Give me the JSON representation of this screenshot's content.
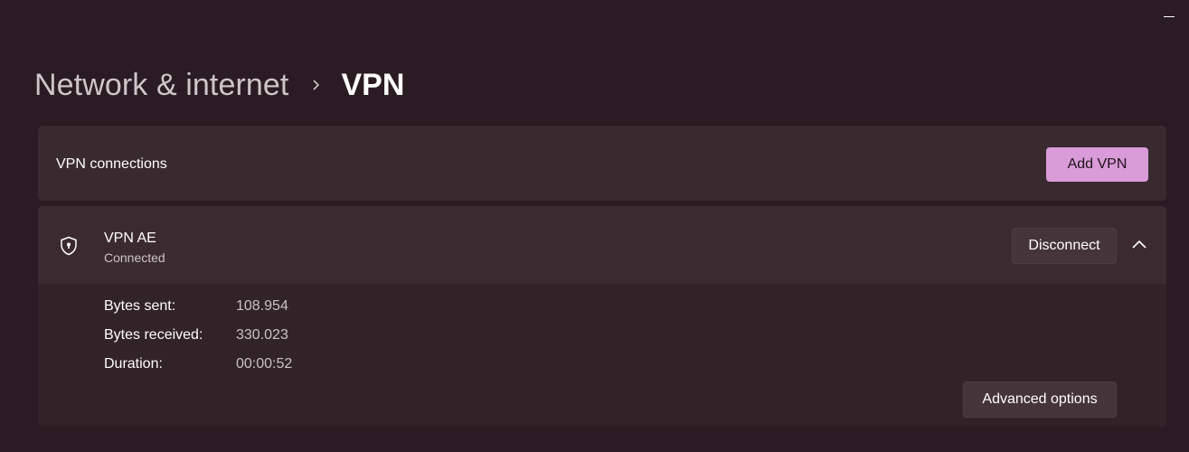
{
  "window": {
    "minimize_icon": "minimize-icon"
  },
  "breadcrumb": {
    "parent": "Network & internet",
    "separator_icon": "chevron-right-icon",
    "current": "VPN"
  },
  "connections_card": {
    "title": "VPN connections",
    "add_button_label": "Add VPN"
  },
  "vpn_entry": {
    "icon": "shield-lock-icon",
    "name": "VPN AE",
    "status": "Connected",
    "disconnect_label": "Disconnect",
    "expand_icon": "chevron-up-icon",
    "stats": [
      {
        "label": "Bytes sent:",
        "value": "108.954"
      },
      {
        "label": "Bytes received:",
        "value": "330.023"
      },
      {
        "label": "Duration:",
        "value": "00:00:52"
      }
    ],
    "advanced_label": "Advanced options"
  },
  "colors": {
    "background": "#2b1b22",
    "card": "#392a30",
    "accent": "#d99cd8",
    "secondary_text": "#c9c1c5"
  }
}
